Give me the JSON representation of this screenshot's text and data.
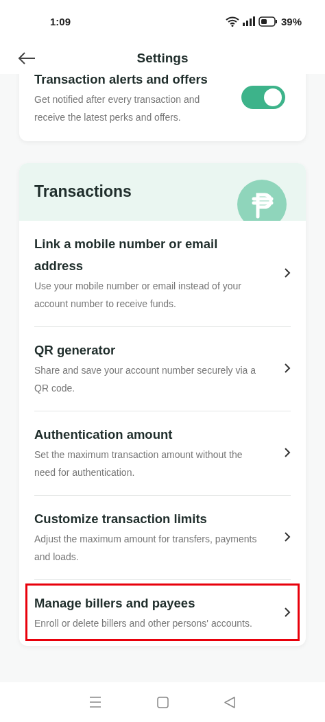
{
  "status_bar": {
    "time": "1:09",
    "battery": "39%"
  },
  "header": {
    "title": "Settings"
  },
  "alerts_card": {
    "title": "Transaction alerts and offers",
    "description": "Get notified after every transaction and receive the latest perks and offers.",
    "on": true
  },
  "transactions": {
    "title": "Transactions",
    "items": [
      {
        "title": "Link a mobile number or email address",
        "description": "Use your mobile number or email instead of your account number to receive funds.",
        "highlighted": false
      },
      {
        "title": "QR generator",
        "description": "Share and save your account number securely via a QR code.",
        "highlighted": false
      },
      {
        "title": "Authentication amount",
        "description": "Set the maximum transaction amount without the need for authentication.",
        "highlighted": false
      },
      {
        "title": "Customize transaction limits",
        "description": "Adjust the maximum amount for transfers, payments and loads.",
        "highlighted": false
      },
      {
        "title": "Manage billers and payees",
        "description": "Enroll or delete billers and other persons' accounts.",
        "highlighted": true
      }
    ]
  }
}
